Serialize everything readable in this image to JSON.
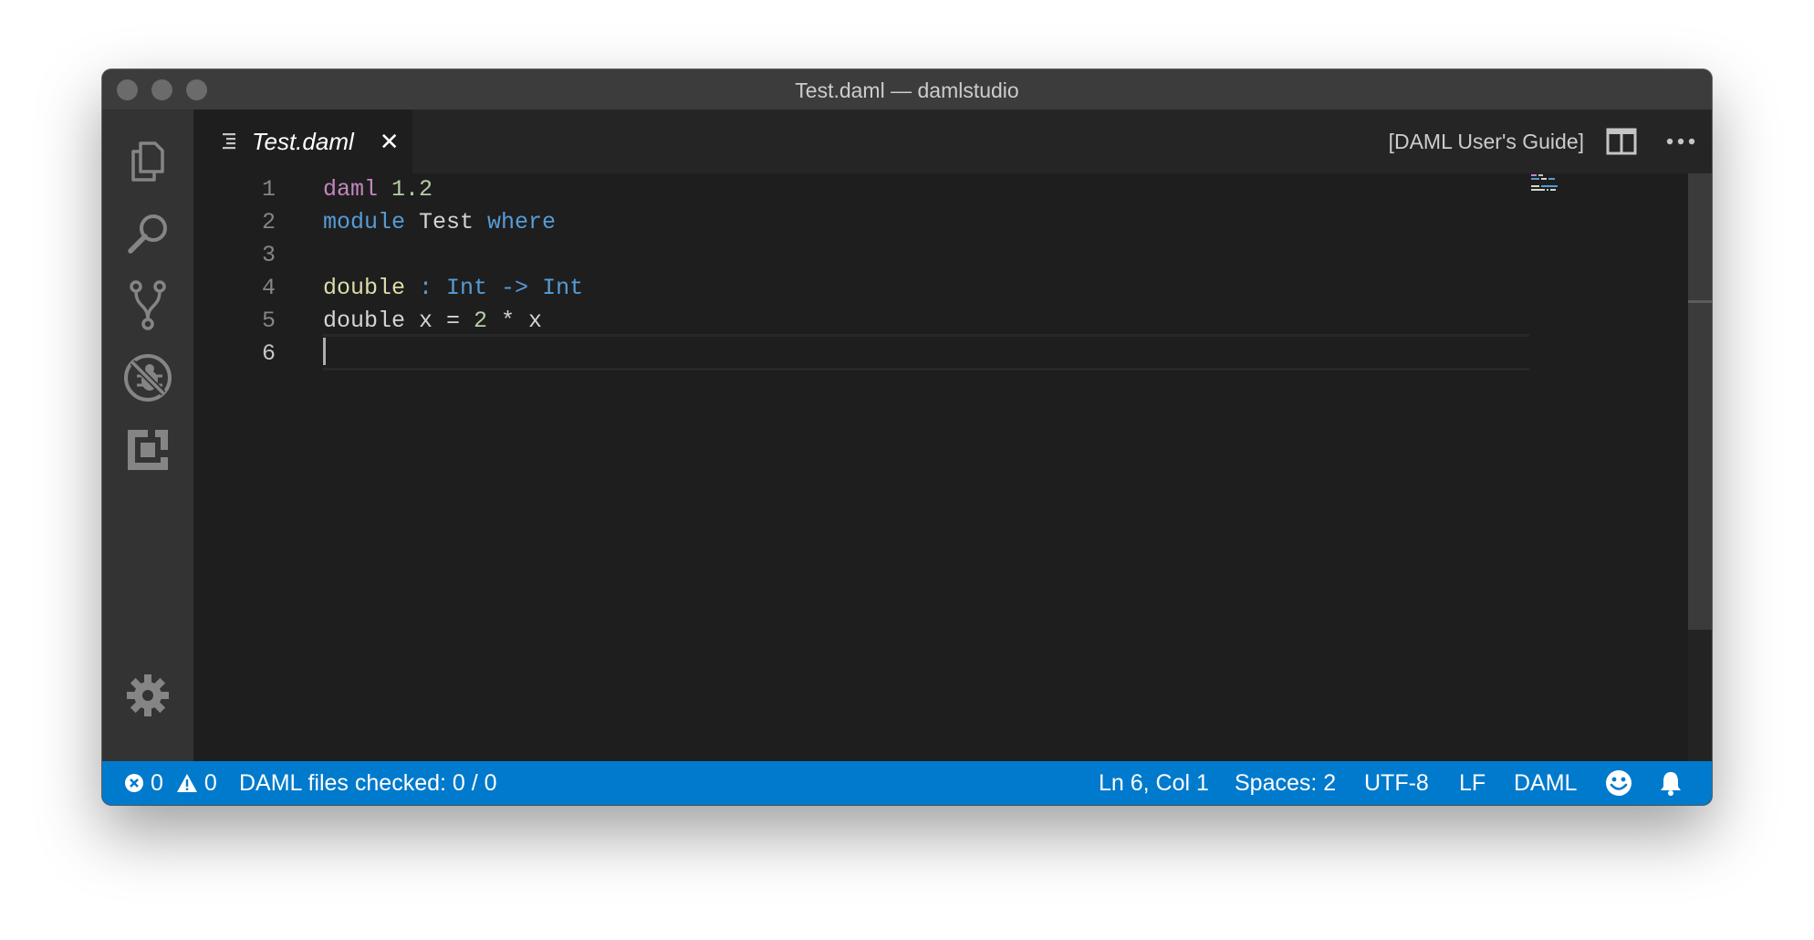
{
  "window": {
    "title": "Test.daml — damlstudio"
  },
  "activity_bar": {
    "items": [
      {
        "icon": "files-icon"
      },
      {
        "icon": "search-icon"
      },
      {
        "icon": "source-control-icon"
      },
      {
        "icon": "debug-icon"
      },
      {
        "icon": "extensions-icon"
      }
    ],
    "settings_icon": "gear-icon"
  },
  "tabs": [
    {
      "label": "Test.daml",
      "close": "✕"
    }
  ],
  "tab_actions": {
    "guide_label": "[DAML User's Guide]",
    "split_icon": "split-editor-icon",
    "more_icon": "more-actions-icon"
  },
  "editor": {
    "active_line": 6,
    "lines": [
      {
        "num": "1",
        "tokens": [
          {
            "t": "daml",
            "c": "#c586c0"
          },
          {
            "t": " ",
            "c": "#d4d4d4"
          },
          {
            "t": "1.2",
            "c": "#b5cea8"
          }
        ]
      },
      {
        "num": "2",
        "tokens": [
          {
            "t": "module",
            "c": "#569cd6"
          },
          {
            "t": " Test ",
            "c": "#d4d4d4"
          },
          {
            "t": "where",
            "c": "#569cd6"
          }
        ]
      },
      {
        "num": "3",
        "tokens": []
      },
      {
        "num": "4",
        "tokens": [
          {
            "t": "double",
            "c": "#dcdcaa"
          },
          {
            "t": " : ",
            "c": "#569cd6"
          },
          {
            "t": "Int",
            "c": "#569cd6"
          },
          {
            "t": " -> ",
            "c": "#569cd6"
          },
          {
            "t": "Int",
            "c": "#569cd6"
          }
        ]
      },
      {
        "num": "5",
        "tokens": [
          {
            "t": "double x = ",
            "c": "#d4d4d4"
          },
          {
            "t": "2",
            "c": "#b5cea8"
          },
          {
            "t": " * x",
            "c": "#d4d4d4"
          }
        ]
      },
      {
        "num": "6",
        "tokens": []
      }
    ]
  },
  "status_bar": {
    "errors": "0",
    "warnings": "0",
    "checked": "DAML files checked: 0 / 0",
    "position": "Ln 6, Col 1",
    "spaces": "Spaces: 2",
    "encoding": "UTF-8",
    "eol": "LF",
    "language": "DAML",
    "feedback_icon": "smiley-icon",
    "notification_icon": "bell-icon"
  },
  "colors": {
    "status_bar": "#007acc",
    "editor_bg": "#1e1e1e",
    "activity_bar": "#333333",
    "title_bar": "#3c3c3c"
  }
}
